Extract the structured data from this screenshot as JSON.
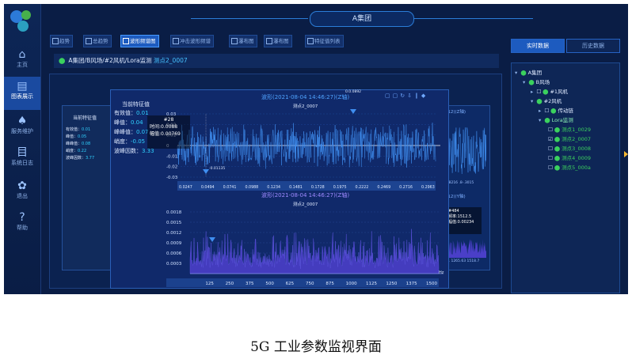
{
  "app": {
    "title": "A集团"
  },
  "nav": [
    {
      "label": "主页",
      "icon": "home-icon",
      "glyph": "⌂"
    },
    {
      "label": "图表展示",
      "icon": "chart-icon",
      "glyph": "▤"
    },
    {
      "label": "服务维护",
      "icon": "bell-icon",
      "glyph": "♠"
    },
    {
      "label": "系统日志",
      "icon": "log-icon",
      "glyph": "目"
    },
    {
      "label": "退出",
      "icon": "exit-icon",
      "glyph": "✿"
    },
    {
      "label": "帮助",
      "icon": "help-icon",
      "glyph": "?"
    }
  ],
  "active_nav": "图表展示",
  "tabs": [
    "趋势",
    "总趋势",
    "波形频谱图",
    "冲击波形频谱",
    "瀑布图",
    "瀑布图",
    "特征值列表"
  ],
  "active_tab": "波形频谱图",
  "breadcrumb": {
    "path": "A集团/B风场/#2风机/Lora监测",
    "point": "测点2_0007"
  },
  "features_back": {
    "title": "当前特征值",
    "items": [
      {
        "label": "有效值",
        "value": "0.01"
      },
      {
        "label": "峰值",
        "value": "0.05"
      },
      {
        "label": "峰峰值",
        "value": "0.08"
      },
      {
        "label": "峭度",
        "value": "0.22"
      },
      {
        "label": "波峰因数",
        "value": "3.77"
      }
    ]
  },
  "features_front": {
    "title": "当前特征值",
    "items": [
      {
        "label": "有效值",
        "value": "0.01"
      },
      {
        "label": "峰值",
        "value": "0.04"
      },
      {
        "label": "峰峰值",
        "value": "0.07"
      },
      {
        "label": "峭度",
        "value": "-0.05"
      },
      {
        "label": "波峰因数",
        "value": "3.33"
      }
    ]
  },
  "waveform": {
    "title": "波形(2021-08-04 14:46:27)(Z轴)",
    "subtitle": "测点2_0007",
    "yticks": [
      "0.03",
      "0.02",
      "0.01",
      "0",
      "-0.01",
      "-0.02",
      "-0.03"
    ],
    "xticks": [
      "0.0247",
      "0.0494",
      "0.0741",
      "0.0988",
      "0.1234",
      "0.1481",
      "0.1728",
      "0.1975",
      "0.2222",
      "0.2469",
      "0.2716",
      "0.2963"
    ],
    "marker_top": "0.0.0892",
    "marker_bottom": "-0.01135",
    "tooltip": {
      "id": "#28",
      "time": "时间:0.0088",
      "amp": "幅值:0.00769"
    }
  },
  "spectrum": {
    "title": "波形(2021-08-04 14:46:27)(Z轴)",
    "subtitle": "测点2_0007",
    "yticks": [
      "0.0018",
      "0.0015",
      "0.0012",
      "0.0009",
      "0.0006",
      "0.0003"
    ],
    "xticks": [
      "125",
      "250",
      "375",
      "500",
      "625",
      "750",
      "875",
      "1000",
      "1125",
      "1250",
      "1375",
      "1500"
    ],
    "unit": "Hz"
  },
  "back_chart": {
    "header1": "7:12)(Z轴)",
    "header2": "7:12)(Y轴)",
    "axis1": "13  .8216  .8-.3015",
    "axis2": "123.  1265.63  1518.7",
    "unit": "Hz",
    "tooltip": {
      "id": "#484",
      "freq": "频率:1512.5",
      "amp": "幅值:0.00234"
    }
  },
  "right_tabs": [
    "实时数据",
    "历史数据"
  ],
  "tree": [
    {
      "label": "A集团",
      "level": 0,
      "kind": "group"
    },
    {
      "label": "B风场",
      "level": 1,
      "kind": "group"
    },
    {
      "label": "#1风机",
      "level": 2,
      "kind": "item"
    },
    {
      "label": "#2风机",
      "level": 2,
      "kind": "group"
    },
    {
      "label": "传动链",
      "level": 3,
      "kind": "item"
    },
    {
      "label": "Lora监测",
      "level": 3,
      "kind": "lora"
    },
    {
      "label": "测点1_0029",
      "level": 4,
      "kind": "point",
      "checked": false
    },
    {
      "label": "测点2_0007",
      "level": 4,
      "kind": "point",
      "checked": true
    },
    {
      "label": "测点3_0008",
      "level": 4,
      "kind": "point",
      "checked": false
    },
    {
      "label": "测点4_0009",
      "level": 4,
      "kind": "point",
      "checked": false
    },
    {
      "label": "测点5_000a",
      "level": 4,
      "kind": "point",
      "checked": false
    }
  ],
  "caption": "5G 工业参数监视界面",
  "colors": {
    "bg": "#0a1d45",
    "accent": "#1d5bbf",
    "wave": "#3f8ef0",
    "spectrum": "#6a5cf0",
    "green": "#3bd15e"
  }
}
